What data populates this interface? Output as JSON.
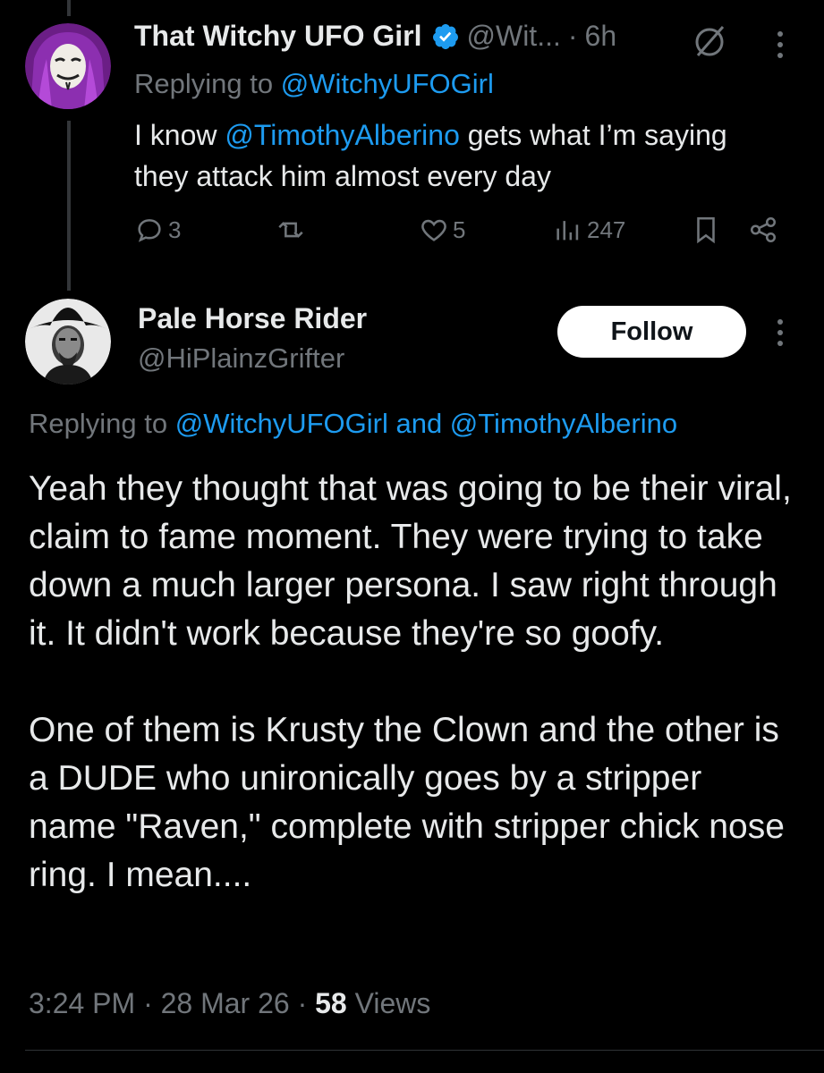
{
  "tweet1": {
    "display_name": "That Witchy UFO Girl",
    "handle": "@Wit...",
    "separator": "·",
    "time": "6h",
    "replying_prefix": "Replying to ",
    "replying_to": "@WitchyUFOGirl",
    "body_before": "I know ",
    "body_mention": "@TimothyAlberino",
    "body_after": " gets what I’m saying they attack him almost every day",
    "replies": "3",
    "likes": "5",
    "views": "247"
  },
  "tweet2": {
    "display_name": "Pale Horse Rider",
    "handle": "@HiPlainzGrifter",
    "follow_label": "Follow",
    "replying_prefix": "Replying to ",
    "replying_to_1": "@WitchyUFOGirl",
    "replying_and": " and ",
    "replying_to_2": "@TimothyAlberino",
    "paragraph1": "Yeah they thought that was going to be their viral, claim to fame moment.  They were trying to take down a much larger persona.  I saw right through it.  It didn't work because they're so goofy.",
    "paragraph2": "One of them is Krusty the Clown and the other is a DUDE who unironically goes by a stripper name \"Raven,\" complete with stripper chick nose ring.  I mean....",
    "time": "3:24 PM",
    "sep": " · ",
    "date": "28 Mar 26",
    "views_count": "58",
    "views_label": " Views"
  },
  "icons": {
    "verified": "verified-badge-icon",
    "reply": "reply-icon",
    "repost": "repost-icon",
    "like": "heart-icon",
    "views": "views-chart-icon",
    "bookmark": "bookmark-icon",
    "share": "share-icon",
    "more": "more-dots-icon",
    "muted": "not-interested-icon"
  },
  "colors": {
    "background": "#000000",
    "text": "#e7e9ea",
    "secondary": "#71767b",
    "link": "#1d9bf0"
  }
}
